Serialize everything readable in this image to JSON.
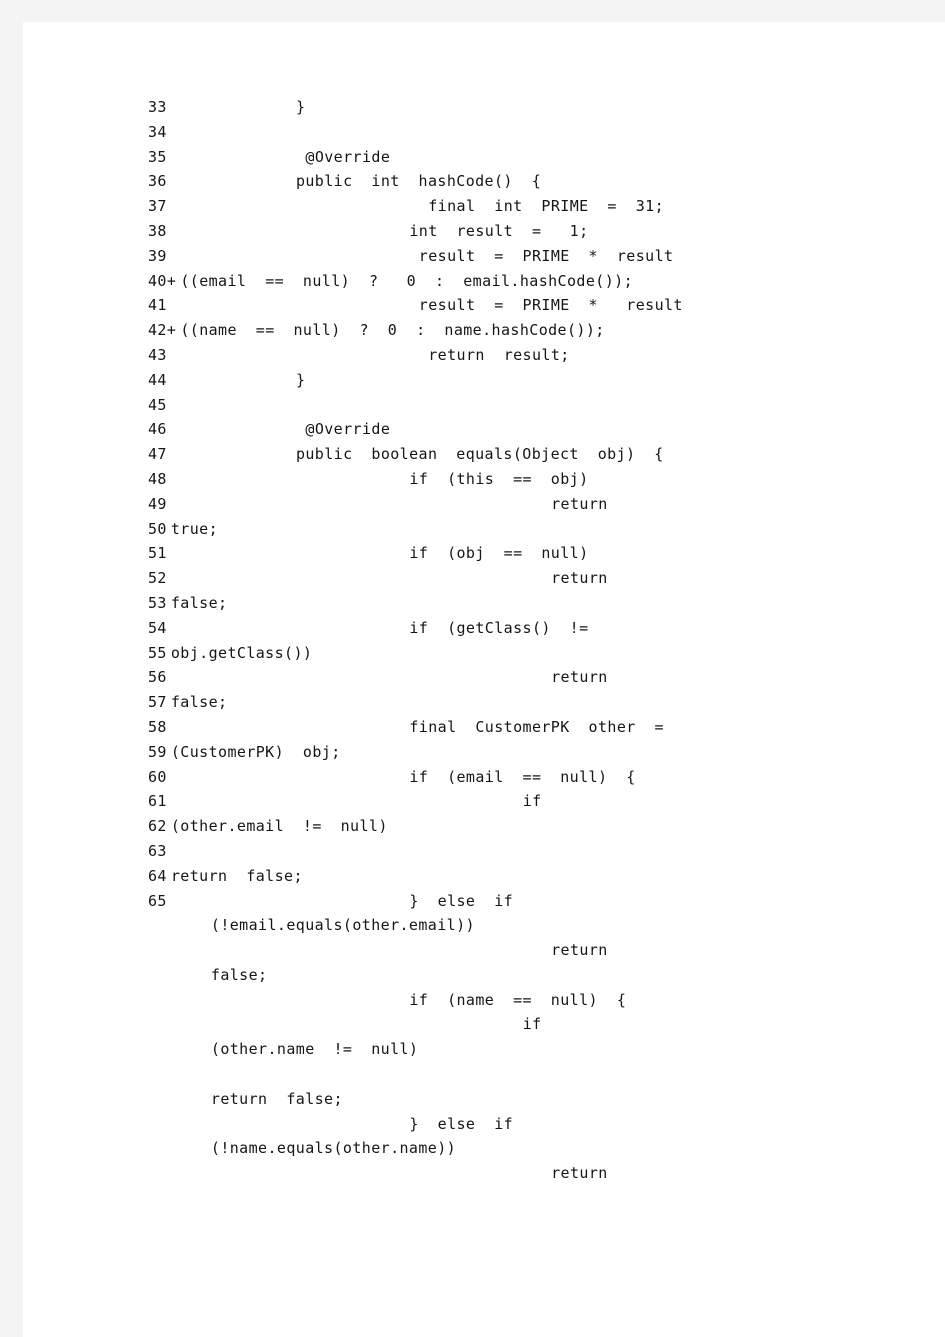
{
  "page": {
    "background_color": "#f4f4f5",
    "paper_color": "#ffffff",
    "text_color": "#161616"
  },
  "code_listing": {
    "language": "java",
    "description": "Java source code excerpt showing hashCode() and equals() overrides for class CustomerPK",
    "lines": [
      {
        "number": "33",
        "indent": 11,
        "code": "}"
      },
      {
        "number": "34",
        "indent": 0,
        "code": ""
      },
      {
        "number": "35",
        "indent": 12,
        "code": "@Override"
      },
      {
        "number": "36",
        "indent": 11,
        "code": "public  int  hashCode()  {"
      },
      {
        "number": "37",
        "indent": 25,
        "code": "final  int  PRIME  =  31;"
      },
      {
        "number": "38",
        "indent": 23,
        "code": "int  result  =   1;"
      },
      {
        "number": "39",
        "indent": 24,
        "code": "result  =  PRIME  *  result"
      },
      {
        "number": "40+",
        "indent": 1,
        "code": "((email  ==  null)  ?   0  :  email.hashCode());",
        "wrapped": true
      },
      {
        "number": "41",
        "indent": 24,
        "code": "result  =  PRIME  *   result"
      },
      {
        "number": "42+",
        "indent": 1,
        "code": "((name  ==  null)  ?  0  :  name.hashCode());",
        "wrapped": true
      },
      {
        "number": "43",
        "indent": 25,
        "code": "return  result;"
      },
      {
        "number": "44",
        "indent": 11,
        "code": "}"
      },
      {
        "number": "45",
        "indent": 0,
        "code": ""
      },
      {
        "number": "46",
        "indent": 12,
        "code": "@Override"
      },
      {
        "number": "47",
        "indent": 11,
        "code": "public  boolean  equals(Object  obj)  {"
      },
      {
        "number": "48",
        "indent": 23,
        "code": "if  (this  ==  obj)"
      },
      {
        "number": "49",
        "indent": 38,
        "code": "return"
      },
      {
        "number": "50",
        "indent": 0,
        "code": "true;",
        "wrapped": true
      },
      {
        "number": "51",
        "indent": 23,
        "code": "if  (obj  ==  null)"
      },
      {
        "number": "52",
        "indent": 38,
        "code": "return"
      },
      {
        "number": "53",
        "indent": 0,
        "code": "false;",
        "wrapped": true
      },
      {
        "number": "54",
        "indent": 23,
        "code": "if  (getClass()  !="
      },
      {
        "number": "55",
        "indent": 0,
        "code": "obj.getClass())",
        "wrapped": true
      },
      {
        "number": "56",
        "indent": 38,
        "code": "return"
      },
      {
        "number": "57",
        "indent": 0,
        "code": "false;",
        "wrapped": true
      },
      {
        "number": "58",
        "indent": 23,
        "code": "final  CustomerPK  other  ="
      },
      {
        "number": "59",
        "indent": 0,
        "code": "(CustomerPK)  obj;",
        "wrapped": true
      },
      {
        "number": "60",
        "indent": 23,
        "code": "if  (email  ==  null)  {"
      },
      {
        "number": "61",
        "indent": 35,
        "code": "if"
      },
      {
        "number": "62",
        "indent": 0,
        "code": "(other.email  !=  null)",
        "wrapped": true
      },
      {
        "number": "63",
        "indent": 0,
        "code": ""
      },
      {
        "number": "64",
        "indent": 0,
        "code": "return  false;",
        "wrapped": true
      },
      {
        "number": "65",
        "indent": 23,
        "code": "}  else  if"
      },
      {
        "number": "",
        "indent": 2,
        "code": "(!email.equals(other.email))"
      },
      {
        "number": "",
        "indent": 38,
        "code": "return"
      },
      {
        "number": "",
        "indent": 2,
        "code": "false;"
      },
      {
        "number": "",
        "indent": 23,
        "code": "if  (name  ==  null)  {"
      },
      {
        "number": "",
        "indent": 35,
        "code": "if"
      },
      {
        "number": "",
        "indent": 2,
        "code": "(other.name  !=  null)"
      },
      {
        "number": "",
        "indent": 0,
        "code": ""
      },
      {
        "number": "",
        "indent": 2,
        "code": "return  false;"
      },
      {
        "number": "",
        "indent": 23,
        "code": "}  else  if"
      },
      {
        "number": "",
        "indent": 2,
        "code": "(!name.equals(other.name))"
      },
      {
        "number": "",
        "indent": 38,
        "code": "return"
      }
    ]
  }
}
